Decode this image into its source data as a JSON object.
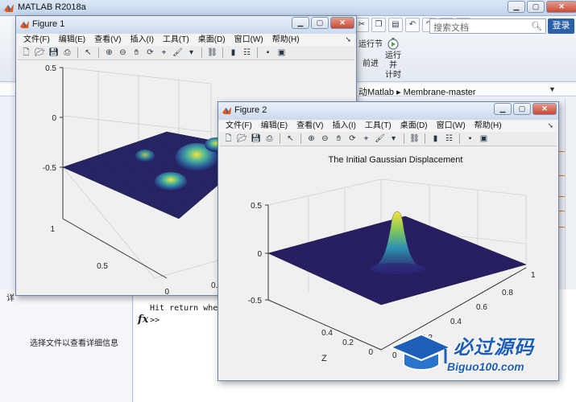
{
  "main": {
    "title": "MATLAB R2018a",
    "search_placeholder": "搜索文档",
    "login_label": "登录",
    "run_section_label": "运行节",
    "run_advance_label": "前进",
    "run_time_label_1": "运行并",
    "run_time_label_2": "计时",
    "path_text": "桌面 ▸ 启动Matlab ▸ Membrane-master",
    "path_prefix": "动Matlab",
    "path_folder": "Membrane-master",
    "details_text": "选择文件以查看详细信息",
    "command_output": "Hit return when",
    "prompt": ">>",
    "fx": "fx",
    "left_tab_label": "详"
  },
  "figure1": {
    "title": "Figure 1",
    "menus": [
      "文件(F)",
      "编辑(E)",
      "查看(V)",
      "插入(I)",
      "工具(T)",
      "桌面(D)",
      "窗口(W)",
      "帮助(H)"
    ],
    "zticks": [
      "0.5",
      "0",
      "-0.5"
    ],
    "yticks": [
      "1",
      "0.5",
      "0"
    ],
    "xtick_partial": "0."
  },
  "figure2": {
    "title": "Figure 2",
    "menus": [
      "文件(F)",
      "编辑(E)",
      "查看(V)",
      "插入(I)",
      "工具(T)",
      "桌面(D)",
      "窗口(W)",
      "帮助(H)"
    ],
    "plot_title": "The Initial Gaussian Displacement",
    "zticks": [
      "0.5",
      "0",
      "-0.5"
    ],
    "xticks": [
      "1",
      "0.8",
      "0.6",
      "0.4",
      "0.2",
      "0"
    ],
    "yticks": [
      "0",
      "0.2",
      "0.4"
    ],
    "zlabel": "Z"
  },
  "watermark": {
    "title": "必过源码",
    "url": "Biguo100.com"
  },
  "colors": {
    "accent": "#2a61a8",
    "surface_low": "#2a1d6b",
    "surface_high": "#f2e236"
  }
}
